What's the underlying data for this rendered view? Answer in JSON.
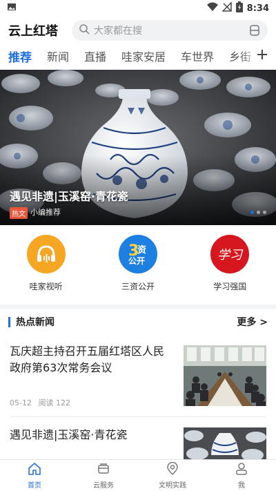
{
  "statusbar": {
    "time": "8:34"
  },
  "header": {
    "title": "云上红塔"
  },
  "search": {
    "placeholder": "大家都在搜"
  },
  "tabs": [
    {
      "label": "推荐",
      "active": true
    },
    {
      "label": "新闻"
    },
    {
      "label": "直播"
    },
    {
      "label": "哇家安居"
    },
    {
      "label": "车世界"
    },
    {
      "label": "乡街"
    }
  ],
  "banner": {
    "title": "遇见非遗|玉溪窑·青花瓷",
    "tag": "热文",
    "subtitle": "小编推荐"
  },
  "quick": [
    {
      "label": "哇家视听",
      "icon": "headphones-icon",
      "color": "#f5a623"
    },
    {
      "label": "三资公开",
      "icon": "sanzi-logo-icon",
      "color": "#1d7fe2",
      "logo_text": "资",
      "logo_text2": "公开"
    },
    {
      "label": "学习强国",
      "icon": "xuexi-logo-icon",
      "color": "#d7171f",
      "logo_text": "学习"
    }
  ],
  "hot": {
    "title": "热点新闻",
    "more": "更多 >",
    "items": [
      {
        "title": "瓦庆超主持召开五届红塔区人民政府第63次常务会议",
        "date": "05-12",
        "reads": "阅读 122"
      },
      {
        "title": "遇见非遗|玉溪窑·青花瓷"
      }
    ]
  },
  "nav": [
    {
      "label": "首页",
      "icon": "home-icon",
      "active": true
    },
    {
      "label": "云服务",
      "icon": "cloud-service-icon"
    },
    {
      "label": "文明实践",
      "icon": "location-icon"
    },
    {
      "label": "我",
      "icon": "user-icon"
    }
  ],
  "colors": {
    "accent": "#1f6fe0",
    "tag": "#e8573c"
  }
}
